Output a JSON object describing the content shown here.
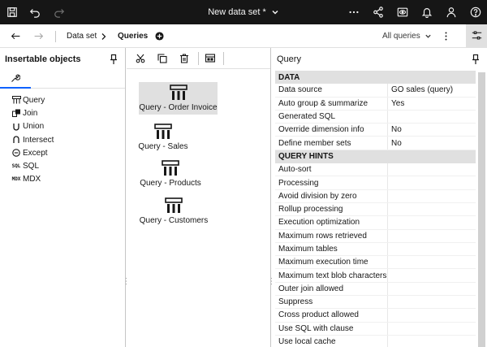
{
  "topbar": {
    "title": "New data set *",
    "icons": [
      "save-icon",
      "undo-icon",
      "redo-icon",
      "more-icon",
      "share-icon",
      "view-icon",
      "notification-icon",
      "user-icon",
      "help-icon"
    ]
  },
  "navbar": {
    "crumb_dataset": "Data set",
    "crumb_queries": "Queries",
    "all_queries": "All queries"
  },
  "left_panel": {
    "title": "Insertable objects",
    "objects": [
      {
        "label": "Query",
        "icon": "query-icon"
      },
      {
        "label": "Join",
        "icon": "join-icon"
      },
      {
        "label": "Union",
        "icon": "union-icon"
      },
      {
        "label": "Intersect",
        "icon": "intersect-icon"
      },
      {
        "label": "Except",
        "icon": "except-icon"
      },
      {
        "label": "SQL",
        "icon": "sql-icon",
        "glyph": "SQL"
      },
      {
        "label": "MDX",
        "icon": "mdx-icon",
        "glyph": "MDX"
      }
    ]
  },
  "center_panel": {
    "queries": [
      {
        "label": "Query - Order Invoice",
        "selected": true
      },
      {
        "label": "Query - Sales",
        "selected": false
      },
      {
        "label": "Query - Products",
        "selected": false
      },
      {
        "label": "Query - Customers",
        "selected": false
      }
    ]
  },
  "right_panel": {
    "title": "Query",
    "sections": [
      {
        "title": "DATA",
        "rows": [
          {
            "key": "Data source",
            "value": "GO sales (query)"
          },
          {
            "key": "Auto group & summarize",
            "value": "Yes"
          },
          {
            "key": "Generated SQL",
            "value": ""
          },
          {
            "key": "Override dimension info",
            "value": "No"
          },
          {
            "key": "Define member sets",
            "value": "No"
          }
        ]
      },
      {
        "title": "QUERY HINTS",
        "rows": [
          {
            "key": "Auto-sort",
            "value": ""
          },
          {
            "key": "Processing",
            "value": ""
          },
          {
            "key": "Avoid division by zero",
            "value": ""
          },
          {
            "key": "Rollup processing",
            "value": ""
          },
          {
            "key": "Execution optimization",
            "value": ""
          },
          {
            "key": "Maximum rows retrieved",
            "value": ""
          },
          {
            "key": "Maximum tables",
            "value": ""
          },
          {
            "key": "Maximum execution time",
            "value": ""
          },
          {
            "key": "Maximum text blob characters",
            "value": ""
          },
          {
            "key": "Outer join allowed",
            "value": ""
          },
          {
            "key": "Suppress",
            "value": ""
          },
          {
            "key": "Cross product allowed",
            "value": ""
          },
          {
            "key": "Use SQL with clause",
            "value": ""
          },
          {
            "key": "Use local cache",
            "value": ""
          }
        ]
      }
    ]
  }
}
